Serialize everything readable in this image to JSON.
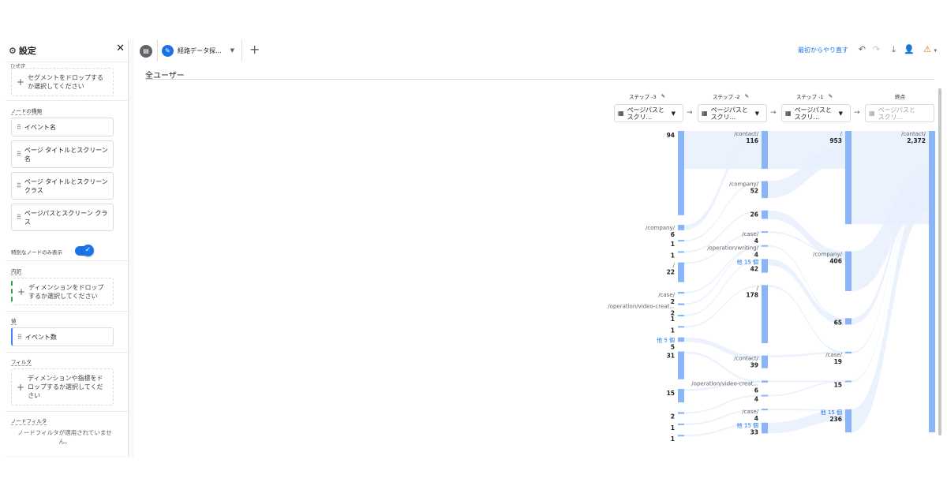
{
  "left_panel": {
    "title": "設定",
    "cut_label": "ひ式定",
    "segment_drop": "セグメントをドロップするか選択してください",
    "node_type_label": "ノードの種類",
    "node_types": [
      "イベント名",
      "ページ タイトルとスクリーン名",
      "ページ タイトルとスクリーン クラス",
      "ページパスとスクリーン クラス"
    ],
    "unique_nodes_label": "特別なノードのみ表示",
    "breakdown_label": "内訳",
    "breakdown_drop": "ディメンションをドロップするか選択してください",
    "values_label": "値",
    "value_chip": "イベント数",
    "filter_label": "フィルタ",
    "filter_drop": "ディメンションや指標をドロップするか選択してください",
    "node_filter_label": "ノードフィルタ",
    "node_filter_text": "ノードフィルタが適用されていません。"
  },
  "tabbar": {
    "tab_label": "経路データ探...",
    "restart": "最初からやり直す"
  },
  "segment_title": "全ユーザー",
  "steps": [
    {
      "label": "ステップ -3",
      "select": "ページパスとスクリ..."
    },
    {
      "label": "ステップ -2",
      "select": "ページパスとスクリ..."
    },
    {
      "label": "ステップ -1",
      "select": "ページパスとスクリ..."
    },
    {
      "label": "終点",
      "select": "ページパスとスクリ..."
    }
  ],
  "colors": {
    "accent": "#1a73e8",
    "node": "#8ab4f8",
    "flow": "#e8f0fe",
    "warning": "#e37400"
  },
  "chart_data": {
    "type": "sankey",
    "columns": [
      {
        "step": "ステップ -3",
        "nodes": [
          {
            "label": "",
            "value": 94
          },
          {
            "label": "/company/",
            "value": 6
          },
          {
            "label": "",
            "value": 1
          },
          {
            "label": "",
            "value": 1
          },
          {
            "label": "/",
            "value": 22
          },
          {
            "label": "/case/",
            "value": 2
          },
          {
            "label": "/operation/video-creat...",
            "value": 2
          },
          {
            "label": "",
            "value": 1
          },
          {
            "label": "",
            "value": 1
          },
          {
            "label": "他 5 個",
            "value": 5,
            "more": true
          },
          {
            "label": "",
            "value": 31
          },
          {
            "label": "",
            "value": 15
          },
          {
            "label": "",
            "value": 2
          },
          {
            "label": "",
            "value": 1
          },
          {
            "label": "",
            "value": 1
          }
        ]
      },
      {
        "step": "ステップ -2",
        "nodes": [
          {
            "label": "/contact/",
            "value": 116
          },
          {
            "label": "/company/",
            "value": 52
          },
          {
            "label": "",
            "value": 26
          },
          {
            "label": "/case/",
            "value": 4
          },
          {
            "label": "/operation/writing/",
            "value": 4
          },
          {
            "label": "他 15 個",
            "value": 42,
            "more": true
          },
          {
            "label": "/",
            "value": 178
          },
          {
            "label": "/contact/",
            "value": 39
          },
          {
            "label": "/operation/video-creat...",
            "value": 6
          },
          {
            "label": "",
            "value": 4
          },
          {
            "label": "/case/",
            "value": 4
          },
          {
            "label": "他 15 個",
            "value": 33,
            "more": true
          }
        ]
      },
      {
        "step": "ステップ -1",
        "nodes": [
          {
            "label": "/",
            "value": 953
          },
          {
            "label": "/company/",
            "value": 406
          },
          {
            "label": "",
            "value": 65
          },
          {
            "label": "/case/",
            "value": 19
          },
          {
            "label": "",
            "value": 15
          },
          {
            "label": "他 15 個",
            "value": 236,
            "more": true
          }
        ]
      },
      {
        "step": "終点",
        "nodes": [
          {
            "label": "/contact/",
            "value": 2372
          }
        ]
      }
    ]
  }
}
